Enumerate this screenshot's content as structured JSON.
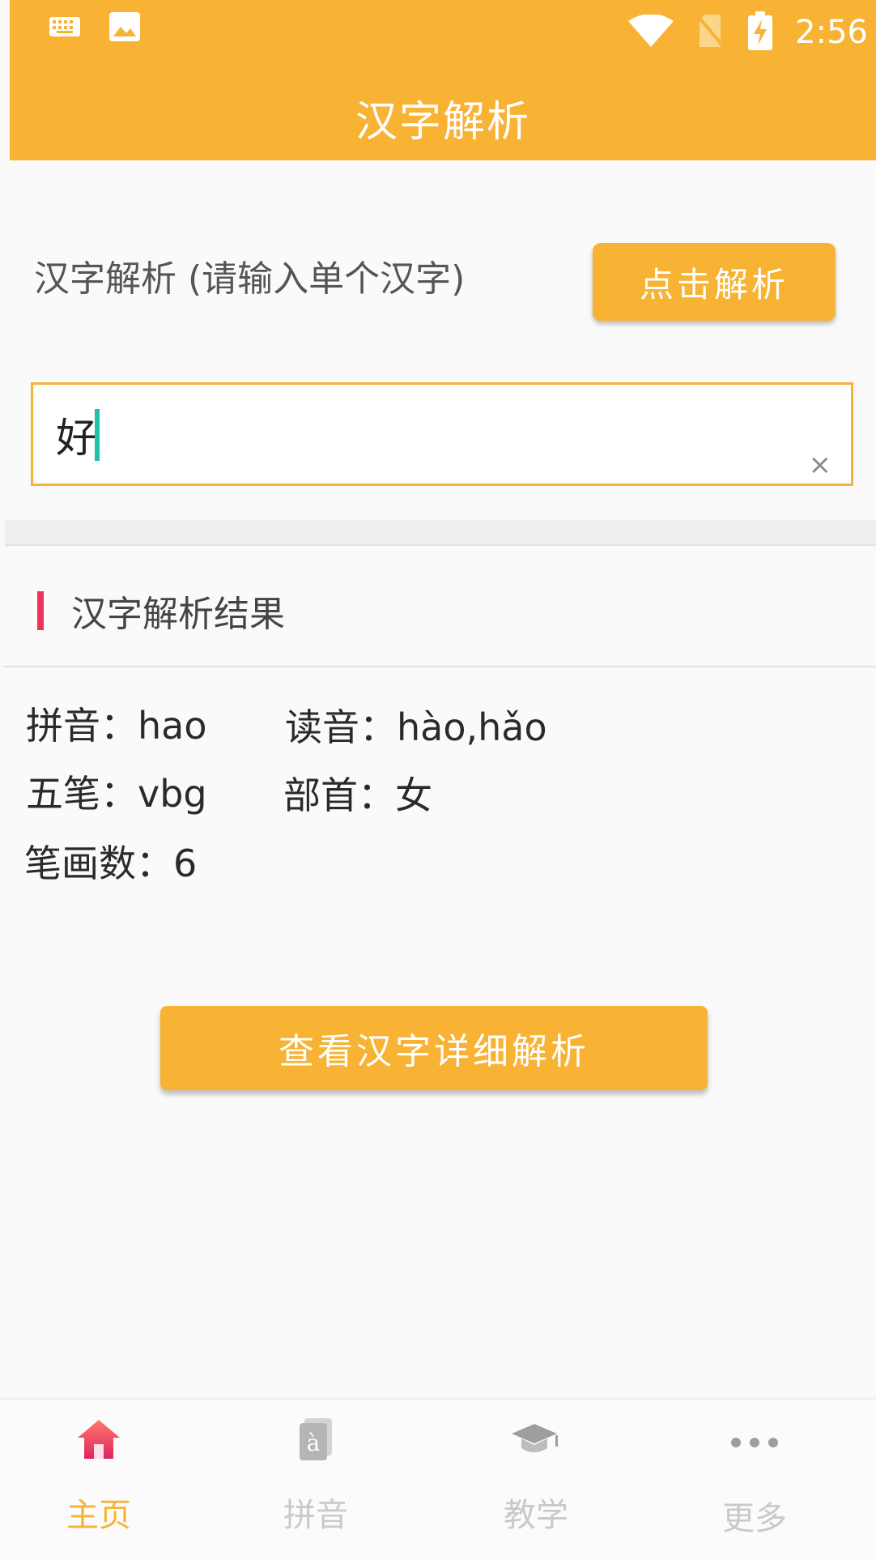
{
  "status_bar": {
    "time": "2:56"
  },
  "app_bar": {
    "title": "汉字解析"
  },
  "input_section": {
    "prompt": "汉字解析 (请输入单个汉字)",
    "parse_button": "点击解析",
    "input_value": "好",
    "clear_symbol": "×"
  },
  "result_section": {
    "title": "汉字解析结果",
    "pinyin_label": "拼音：",
    "pinyin_value": "hao",
    "reading_label": "读音：",
    "reading_value": "hào,hǎo",
    "wubi_label": "五笔：",
    "wubi_value": "vbg",
    "radical_label": "部首：",
    "radical_value": "女",
    "strokes_label": "笔画数：",
    "strokes_value": "6"
  },
  "detail_button": "查看汉字详细解析",
  "bottom_nav": {
    "items": [
      {
        "label": "主页",
        "icon": "home-icon",
        "active": true
      },
      {
        "label": "拼音",
        "icon": "pinyin-card-icon",
        "active": false
      },
      {
        "label": "教学",
        "icon": "graduation-cap-icon",
        "active": false
      },
      {
        "label": "更多",
        "icon": "more-dots-icon",
        "active": false
      }
    ]
  },
  "colors": {
    "accent": "#f8b234",
    "section_marker": "#f0325c",
    "cursor": "#1fbfae",
    "inactive_nav": "#c9c9c9"
  }
}
